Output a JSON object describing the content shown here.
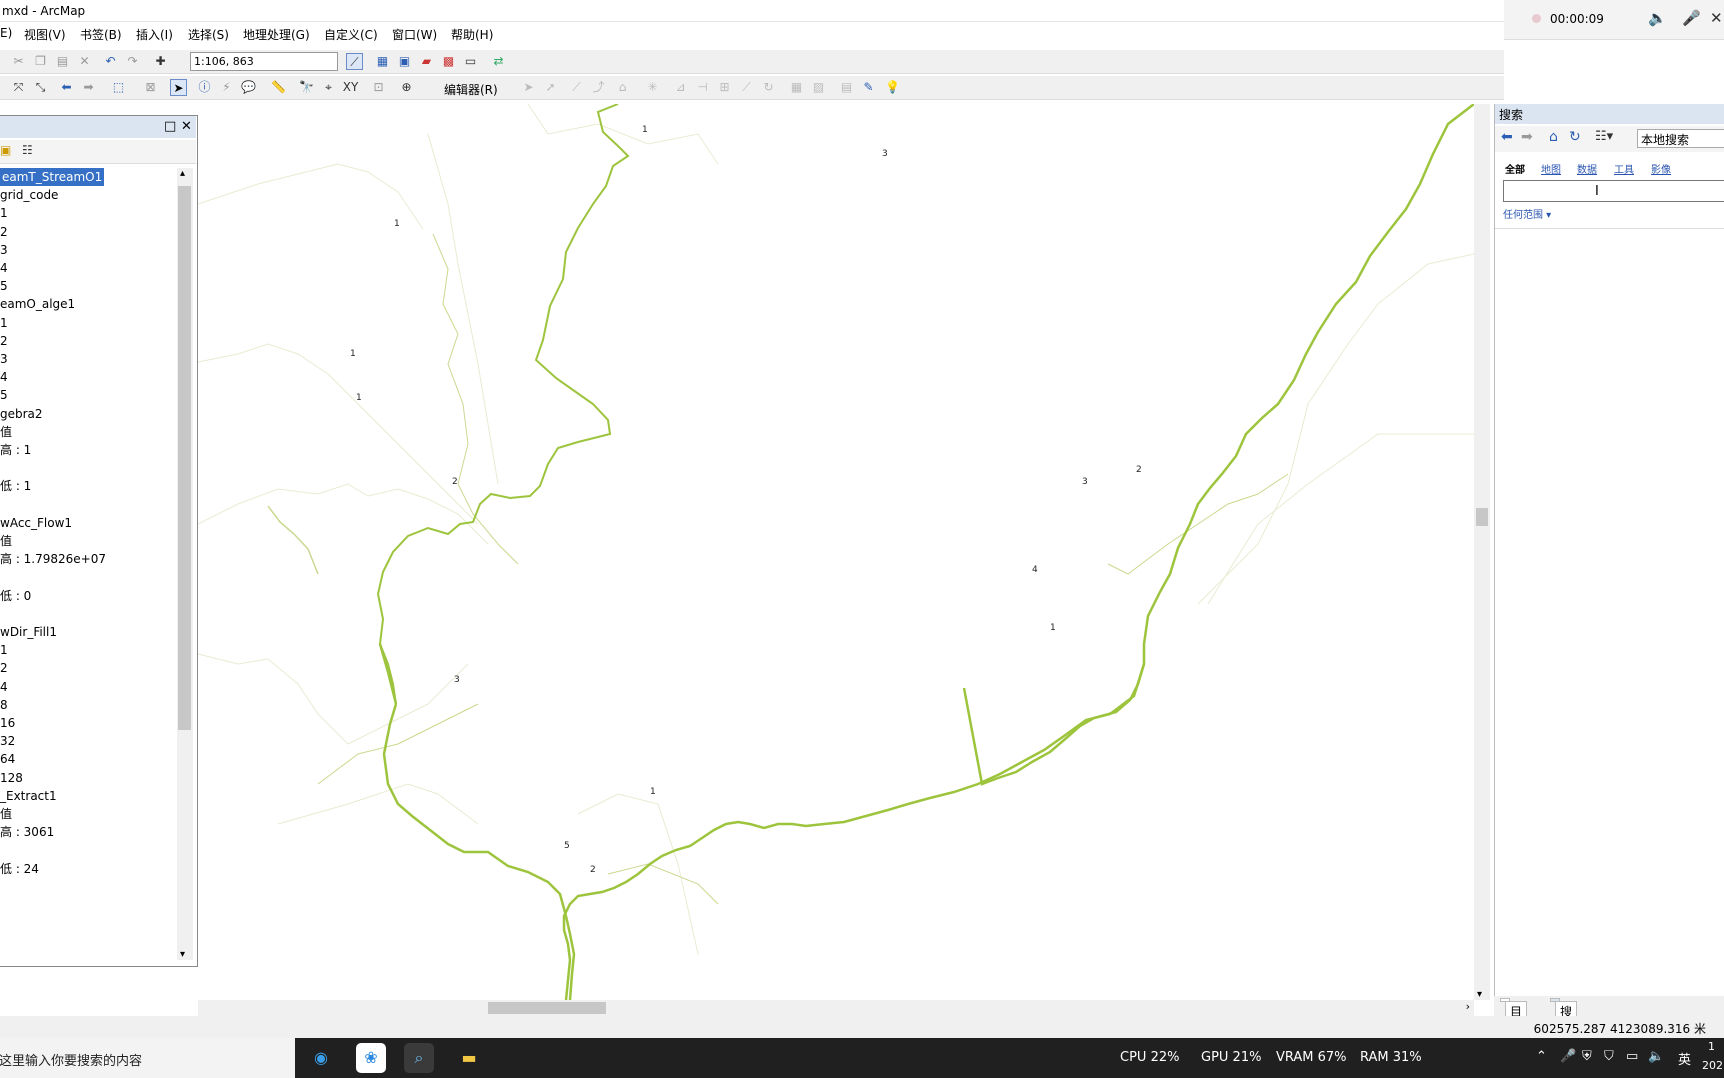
{
  "window": {
    "title": "mxd - ArcMap"
  },
  "recorder": {
    "time": "00:00:09"
  },
  "menu": [
    "E)",
    "视图(V)",
    "书签(B)",
    "插入(I)",
    "选择(S)",
    "地理处理(G)",
    "自定义(C)",
    "窗口(W)",
    "帮助(H)"
  ],
  "toolbar": {
    "scale": "1:106, 863",
    "editor_label": "编辑器(R)"
  },
  "toc": {
    "items": [
      {
        "text": "eamT_StreamO1",
        "selected": true
      },
      {
        "text": "grid_code"
      },
      {
        "text": "1"
      },
      {
        "text": "2"
      },
      {
        "text": "3"
      },
      {
        "text": "4"
      },
      {
        "text": "5"
      },
      {
        "text": "eamO_alge1"
      },
      {
        "text": "1"
      },
      {
        "text": "2"
      },
      {
        "text": "3"
      },
      {
        "text": "4"
      },
      {
        "text": "5"
      },
      {
        "text": "gebra2"
      },
      {
        "text": "值"
      },
      {
        "text": "高 : 1"
      },
      {
        "text": ""
      },
      {
        "text": "低 : 1"
      },
      {
        "text": ""
      },
      {
        "text": "wAcc_Flow1"
      },
      {
        "text": "值"
      },
      {
        "text": "高 : 1.79826e+07"
      },
      {
        "text": ""
      },
      {
        "text": "低 : 0"
      },
      {
        "text": ""
      },
      {
        "text": "wDir_Fill1"
      },
      {
        "text": "1"
      },
      {
        "text": "2"
      },
      {
        "text": "4"
      },
      {
        "text": "8"
      },
      {
        "text": "16"
      },
      {
        "text": "32"
      },
      {
        "text": "64"
      },
      {
        "text": "128"
      },
      {
        "text": "_Extract1"
      },
      {
        "text": "值"
      },
      {
        "text": "高 : 3061"
      },
      {
        "text": ""
      },
      {
        "text": "低 : 24"
      }
    ]
  },
  "map": {
    "labels": [
      {
        "text": "1"
      },
      {
        "text": "3"
      },
      {
        "text": "1"
      },
      {
        "text": "1"
      },
      {
        "text": "1"
      },
      {
        "text": "2"
      },
      {
        "text": "3"
      },
      {
        "text": "2"
      },
      {
        "text": "4"
      },
      {
        "text": "1"
      },
      {
        "text": "3"
      },
      {
        "text": "1"
      },
      {
        "text": "5"
      },
      {
        "text": "2"
      }
    ]
  },
  "search": {
    "title": "搜索",
    "location": "本地搜索",
    "tabs": [
      "全部",
      "地图",
      "数据",
      "工具",
      "影像"
    ],
    "input_value": "",
    "extent": "任何范围"
  },
  "bottom_tabs": [
    "目录",
    "搜索"
  ],
  "status": {
    "coords": "602575.287  4123089.316 米"
  },
  "taskbar": {
    "search_placeholder": "在这里输入你要搜索的内容",
    "cpu": "CPU  22%",
    "gpu": "GPU  21%",
    "vram": "VRAM  67%",
    "ram": "RAM  31%",
    "ime": "英",
    "clock_line1": "1",
    "clock_line2": "202"
  },
  "colors": {
    "stream_major": "#9dc43d",
    "stream_minor": "#e8ecd2",
    "selection": "#3570c6"
  }
}
